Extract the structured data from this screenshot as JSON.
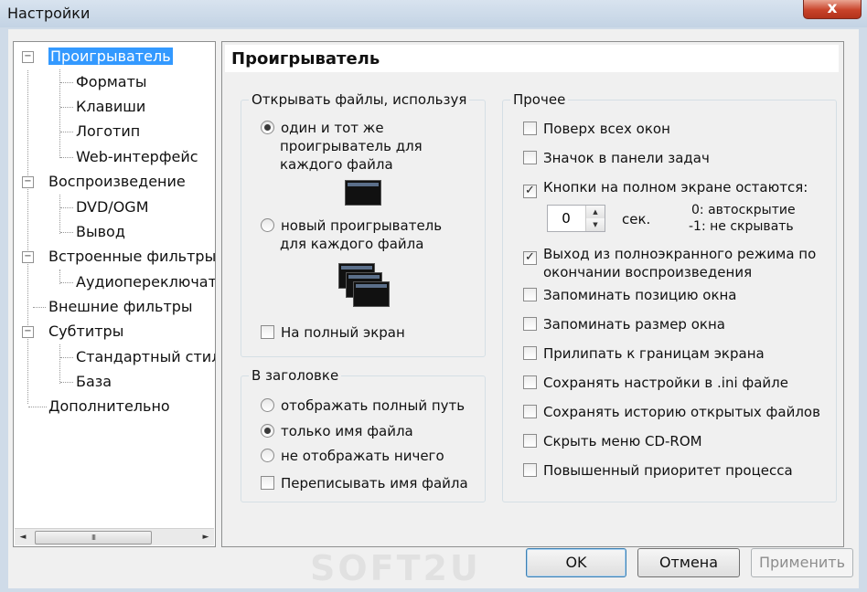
{
  "window": {
    "title": "Настройки",
    "close_label": "x"
  },
  "tree": {
    "items": [
      {
        "label": "Проигрыватель",
        "expander": "−"
      },
      {
        "label": "Форматы"
      },
      {
        "label": "Клавиши"
      },
      {
        "label": "Логотип"
      },
      {
        "label": "Web-интерфейс"
      },
      {
        "label": "Воспроизведение",
        "expander": "−"
      },
      {
        "label": "DVD/OGM"
      },
      {
        "label": "Вывод"
      },
      {
        "label": "Встроенные фильтры",
        "expander": "−"
      },
      {
        "label": "Аудиопереключатель"
      },
      {
        "label": "Внешние фильтры"
      },
      {
        "label": "Субтитры",
        "expander": "−"
      },
      {
        "label": "Стандартный стиль"
      },
      {
        "label": "База"
      },
      {
        "label": "Дополнительно"
      }
    ],
    "selected": "Проигрыватель",
    "scrollbar": {
      "left_arrow": "◄",
      "right_arrow": "►",
      "thumb_grip": "III"
    }
  },
  "panel": {
    "title": "Проигрыватель",
    "open_files": {
      "legend": "Открывать файлы, используя",
      "option_same": {
        "line1": "один и тот же",
        "line2": "проигрыватель для",
        "line3": "каждого файла",
        "checked": true
      },
      "option_new": {
        "line1": "новый проигрыватель",
        "line2": "для каждого файла",
        "checked": false
      },
      "fullscreen": {
        "label": "На полный экран",
        "checked": false
      }
    },
    "caption": {
      "legend": "В заголовке",
      "options": [
        {
          "label": "отображать полный путь",
          "checked": false
        },
        {
          "label": "только имя файла",
          "checked": true
        },
        {
          "label": "не отображать ничего",
          "checked": false
        }
      ],
      "rewrite": {
        "label": "Переписывать имя файла",
        "checked": false
      }
    },
    "other": {
      "legend": "Прочее",
      "items": [
        {
          "label": "Поверх всех окон",
          "checked": false
        },
        {
          "label": "Значок в панели задач",
          "checked": false
        },
        {
          "label": "Кнопки на полном экране остаются:",
          "checked": true
        },
        {
          "label": "Выход из полноэкранного режима по",
          "label2": "окончании воспроизведения",
          "checked": true
        },
        {
          "label": "Запоминать позицию окна",
          "checked": false
        },
        {
          "label": "Запоминать размер окна",
          "checked": false
        },
        {
          "label": "Прилипать к границам экрана",
          "checked": false
        },
        {
          "label": "Сохранять настройки в .ini файле",
          "checked": false
        },
        {
          "label": "Сохранять историю открытых файлов",
          "checked": false
        },
        {
          "label": "Скрыть меню CD-ROM",
          "checked": false
        },
        {
          "label": "Повышенный приоритет процесса",
          "checked": false
        }
      ],
      "timeout": {
        "value": "0",
        "unit": "сек.",
        "hint1": "0: автоскрытие",
        "hint2": "-1: не скрывать",
        "up": "▲",
        "down": "▼"
      }
    },
    "check_mark": "✓"
  },
  "buttons": {
    "ok": "OK",
    "cancel": "Отмена",
    "apply": "Применить"
  },
  "watermark": "SOFT2U"
}
